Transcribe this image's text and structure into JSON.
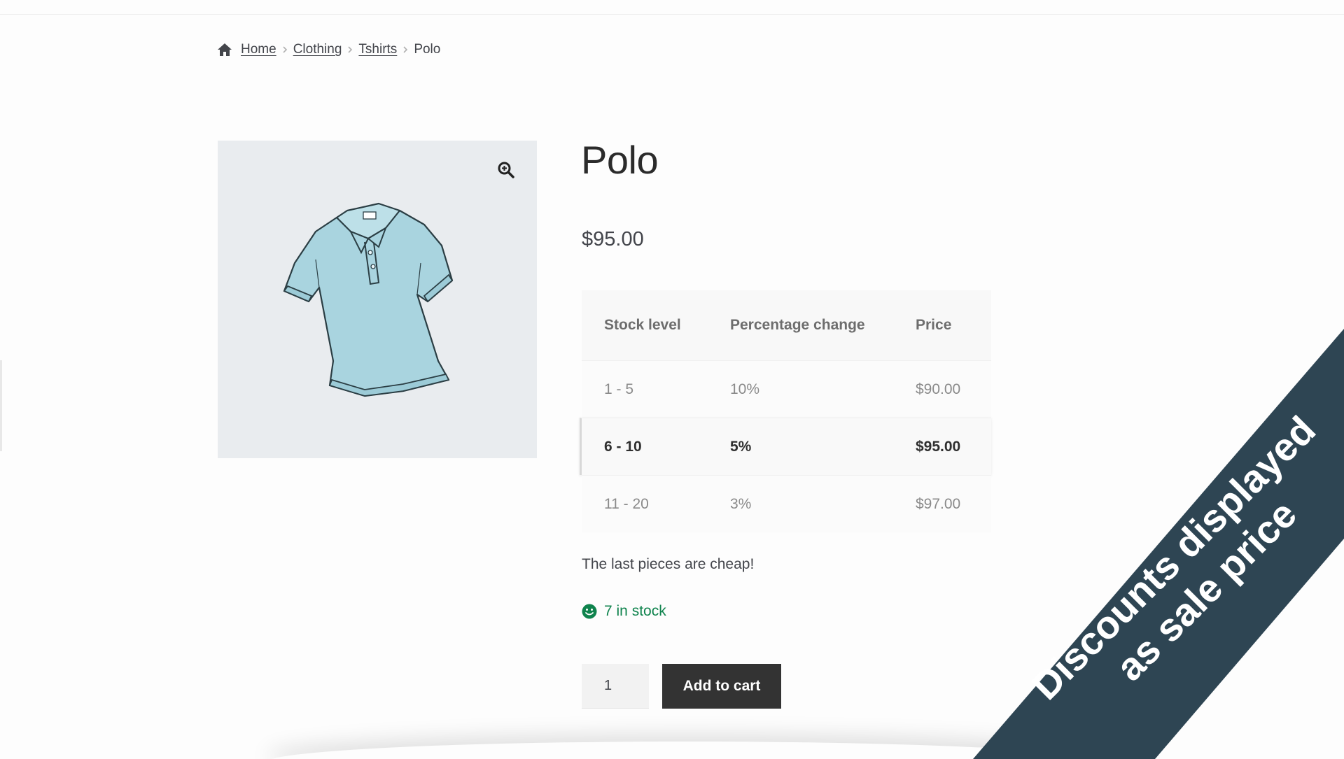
{
  "breadcrumb": {
    "home": "Home",
    "level1": "Clothing",
    "level2": "Tshirts",
    "current": "Polo"
  },
  "product": {
    "title": "Polo",
    "price": "$95.00",
    "short_description": "The last pieces are cheap!",
    "stock_status": "7 in stock",
    "quantity": "1",
    "add_to_cart_label": "Add to cart"
  },
  "pricing_table": {
    "headers": [
      "Stock level",
      "Percentage change",
      "Price"
    ],
    "rows": [
      {
        "stock_level": "1 - 5",
        "percentage_change": "10%",
        "price": "$90.00",
        "active": false
      },
      {
        "stock_level": "6 - 10",
        "percentage_change": "5%",
        "price": "$95.00",
        "active": true
      },
      {
        "stock_level": "11 - 20",
        "percentage_change": "3%",
        "price": "$97.00",
        "active": false
      }
    ]
  },
  "ribbon": {
    "line1": "Discounts displayed",
    "line2": "as sale price",
    "color": "#2e4553"
  },
  "icons": {
    "home": "home-icon",
    "separator": "chevron-right-icon",
    "zoom": "zoom-in-icon",
    "stock": "smiley-icon",
    "product_image": "polo-shirt-image"
  },
  "colors": {
    "stock_green": "#0f834d",
    "button_bg": "#333333",
    "gallery_bg": "#e9ecef"
  }
}
